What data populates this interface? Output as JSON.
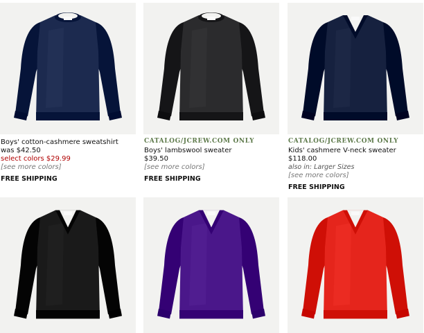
{
  "products": [
    {
      "name": "Boys' cotton-cashmere sweatshirt",
      "was_price": "was $42.50",
      "sale_price": "select colors $29.99",
      "more_colors": "[see more colors]",
      "shipping": "FREE SHIPPING",
      "color": "#1c2a4f",
      "neck": "crew"
    },
    {
      "catalog_label": "CATALOG/JCREW.COM ONLY",
      "name": "Boys' lambswool sweater",
      "price": "$39.50",
      "more_colors": "[see more colors]",
      "shipping": "FREE SHIPPING",
      "color": "#2b2b2d",
      "neck": "crew"
    },
    {
      "catalog_label": "CATALOG/JCREW.COM ONLY",
      "name": "Kids' cashmere V-neck sweater",
      "price": "$118.00",
      "also_in": "also in: Larger Sizes",
      "more_colors": "[see more colors]",
      "shipping": "FREE SHIPPING",
      "color": "#16213f",
      "neck": "v"
    },
    {
      "color": "#1a1a1a",
      "neck": "v"
    },
    {
      "color": "#4a178a",
      "neck": "v"
    },
    {
      "color": "#e5251c",
      "neck": "v"
    }
  ]
}
